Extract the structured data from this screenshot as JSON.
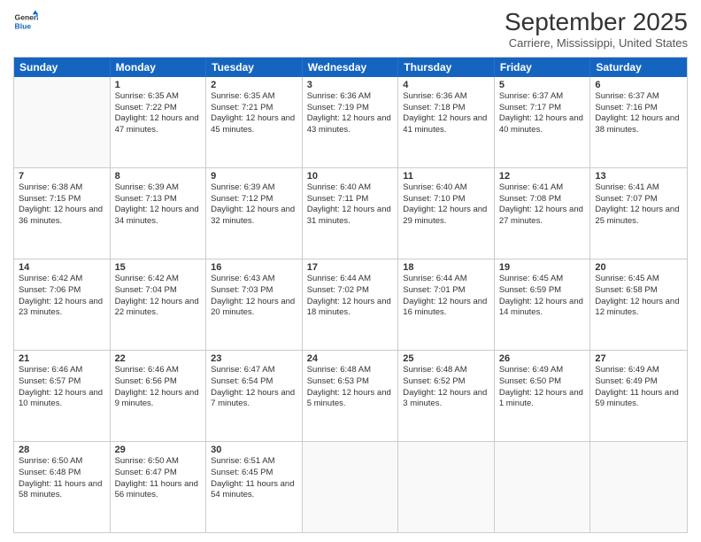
{
  "header": {
    "logo_line1": "General",
    "logo_line2": "Blue",
    "month_title": "September 2025",
    "location": "Carriere, Mississippi, United States"
  },
  "days_of_week": [
    "Sunday",
    "Monday",
    "Tuesday",
    "Wednesday",
    "Thursday",
    "Friday",
    "Saturday"
  ],
  "weeks": [
    [
      {
        "day": "",
        "empty": true
      },
      {
        "day": "1",
        "sunrise": "Sunrise: 6:35 AM",
        "sunset": "Sunset: 7:22 PM",
        "daylight": "Daylight: 12 hours and 47 minutes."
      },
      {
        "day": "2",
        "sunrise": "Sunrise: 6:35 AM",
        "sunset": "Sunset: 7:21 PM",
        "daylight": "Daylight: 12 hours and 45 minutes."
      },
      {
        "day": "3",
        "sunrise": "Sunrise: 6:36 AM",
        "sunset": "Sunset: 7:19 PM",
        "daylight": "Daylight: 12 hours and 43 minutes."
      },
      {
        "day": "4",
        "sunrise": "Sunrise: 6:36 AM",
        "sunset": "Sunset: 7:18 PM",
        "daylight": "Daylight: 12 hours and 41 minutes."
      },
      {
        "day": "5",
        "sunrise": "Sunrise: 6:37 AM",
        "sunset": "Sunset: 7:17 PM",
        "daylight": "Daylight: 12 hours and 40 minutes."
      },
      {
        "day": "6",
        "sunrise": "Sunrise: 6:37 AM",
        "sunset": "Sunset: 7:16 PM",
        "daylight": "Daylight: 12 hours and 38 minutes."
      }
    ],
    [
      {
        "day": "7",
        "sunrise": "Sunrise: 6:38 AM",
        "sunset": "Sunset: 7:15 PM",
        "daylight": "Daylight: 12 hours and 36 minutes."
      },
      {
        "day": "8",
        "sunrise": "Sunrise: 6:39 AM",
        "sunset": "Sunset: 7:13 PM",
        "daylight": "Daylight: 12 hours and 34 minutes."
      },
      {
        "day": "9",
        "sunrise": "Sunrise: 6:39 AM",
        "sunset": "Sunset: 7:12 PM",
        "daylight": "Daylight: 12 hours and 32 minutes."
      },
      {
        "day": "10",
        "sunrise": "Sunrise: 6:40 AM",
        "sunset": "Sunset: 7:11 PM",
        "daylight": "Daylight: 12 hours and 31 minutes."
      },
      {
        "day": "11",
        "sunrise": "Sunrise: 6:40 AM",
        "sunset": "Sunset: 7:10 PM",
        "daylight": "Daylight: 12 hours and 29 minutes."
      },
      {
        "day": "12",
        "sunrise": "Sunrise: 6:41 AM",
        "sunset": "Sunset: 7:08 PM",
        "daylight": "Daylight: 12 hours and 27 minutes."
      },
      {
        "day": "13",
        "sunrise": "Sunrise: 6:41 AM",
        "sunset": "Sunset: 7:07 PM",
        "daylight": "Daylight: 12 hours and 25 minutes."
      }
    ],
    [
      {
        "day": "14",
        "sunrise": "Sunrise: 6:42 AM",
        "sunset": "Sunset: 7:06 PM",
        "daylight": "Daylight: 12 hours and 23 minutes."
      },
      {
        "day": "15",
        "sunrise": "Sunrise: 6:42 AM",
        "sunset": "Sunset: 7:04 PM",
        "daylight": "Daylight: 12 hours and 22 minutes."
      },
      {
        "day": "16",
        "sunrise": "Sunrise: 6:43 AM",
        "sunset": "Sunset: 7:03 PM",
        "daylight": "Daylight: 12 hours and 20 minutes."
      },
      {
        "day": "17",
        "sunrise": "Sunrise: 6:44 AM",
        "sunset": "Sunset: 7:02 PM",
        "daylight": "Daylight: 12 hours and 18 minutes."
      },
      {
        "day": "18",
        "sunrise": "Sunrise: 6:44 AM",
        "sunset": "Sunset: 7:01 PM",
        "daylight": "Daylight: 12 hours and 16 minutes."
      },
      {
        "day": "19",
        "sunrise": "Sunrise: 6:45 AM",
        "sunset": "Sunset: 6:59 PM",
        "daylight": "Daylight: 12 hours and 14 minutes."
      },
      {
        "day": "20",
        "sunrise": "Sunrise: 6:45 AM",
        "sunset": "Sunset: 6:58 PM",
        "daylight": "Daylight: 12 hours and 12 minutes."
      }
    ],
    [
      {
        "day": "21",
        "sunrise": "Sunrise: 6:46 AM",
        "sunset": "Sunset: 6:57 PM",
        "daylight": "Daylight: 12 hours and 10 minutes."
      },
      {
        "day": "22",
        "sunrise": "Sunrise: 6:46 AM",
        "sunset": "Sunset: 6:56 PM",
        "daylight": "Daylight: 12 hours and 9 minutes."
      },
      {
        "day": "23",
        "sunrise": "Sunrise: 6:47 AM",
        "sunset": "Sunset: 6:54 PM",
        "daylight": "Daylight: 12 hours and 7 minutes."
      },
      {
        "day": "24",
        "sunrise": "Sunrise: 6:48 AM",
        "sunset": "Sunset: 6:53 PM",
        "daylight": "Daylight: 12 hours and 5 minutes."
      },
      {
        "day": "25",
        "sunrise": "Sunrise: 6:48 AM",
        "sunset": "Sunset: 6:52 PM",
        "daylight": "Daylight: 12 hours and 3 minutes."
      },
      {
        "day": "26",
        "sunrise": "Sunrise: 6:49 AM",
        "sunset": "Sunset: 6:50 PM",
        "daylight": "Daylight: 12 hours and 1 minute."
      },
      {
        "day": "27",
        "sunrise": "Sunrise: 6:49 AM",
        "sunset": "Sunset: 6:49 PM",
        "daylight": "Daylight: 11 hours and 59 minutes."
      }
    ],
    [
      {
        "day": "28",
        "sunrise": "Sunrise: 6:50 AM",
        "sunset": "Sunset: 6:48 PM",
        "daylight": "Daylight: 11 hours and 58 minutes."
      },
      {
        "day": "29",
        "sunrise": "Sunrise: 6:50 AM",
        "sunset": "Sunset: 6:47 PM",
        "daylight": "Daylight: 11 hours and 56 minutes."
      },
      {
        "day": "30",
        "sunrise": "Sunrise: 6:51 AM",
        "sunset": "Sunset: 6:45 PM",
        "daylight": "Daylight: 11 hours and 54 minutes."
      },
      {
        "day": "",
        "empty": true
      },
      {
        "day": "",
        "empty": true
      },
      {
        "day": "",
        "empty": true
      },
      {
        "day": "",
        "empty": true
      }
    ]
  ]
}
